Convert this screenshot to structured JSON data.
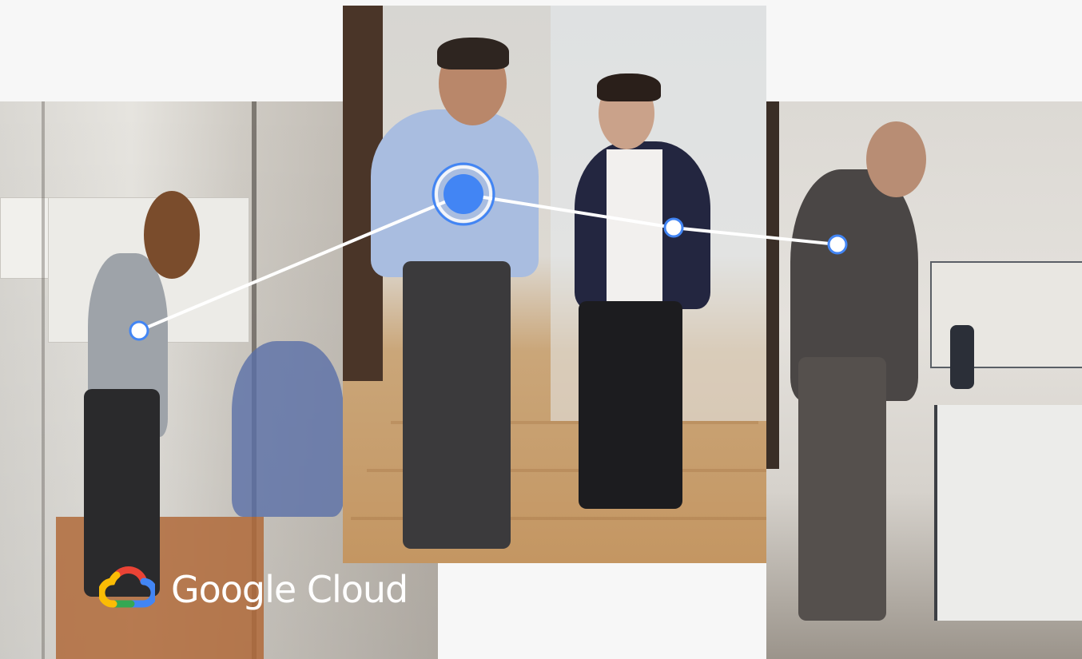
{
  "logo": {
    "icon": "google-cloud-logo-icon",
    "text": "Google Cloud"
  },
  "colors": {
    "background": "#f7f7f7",
    "accent_blue": "#4285f4",
    "line": "#ffffff",
    "google_red": "#ea4335",
    "google_yellow": "#fbbc05",
    "google_green": "#34a853"
  }
}
